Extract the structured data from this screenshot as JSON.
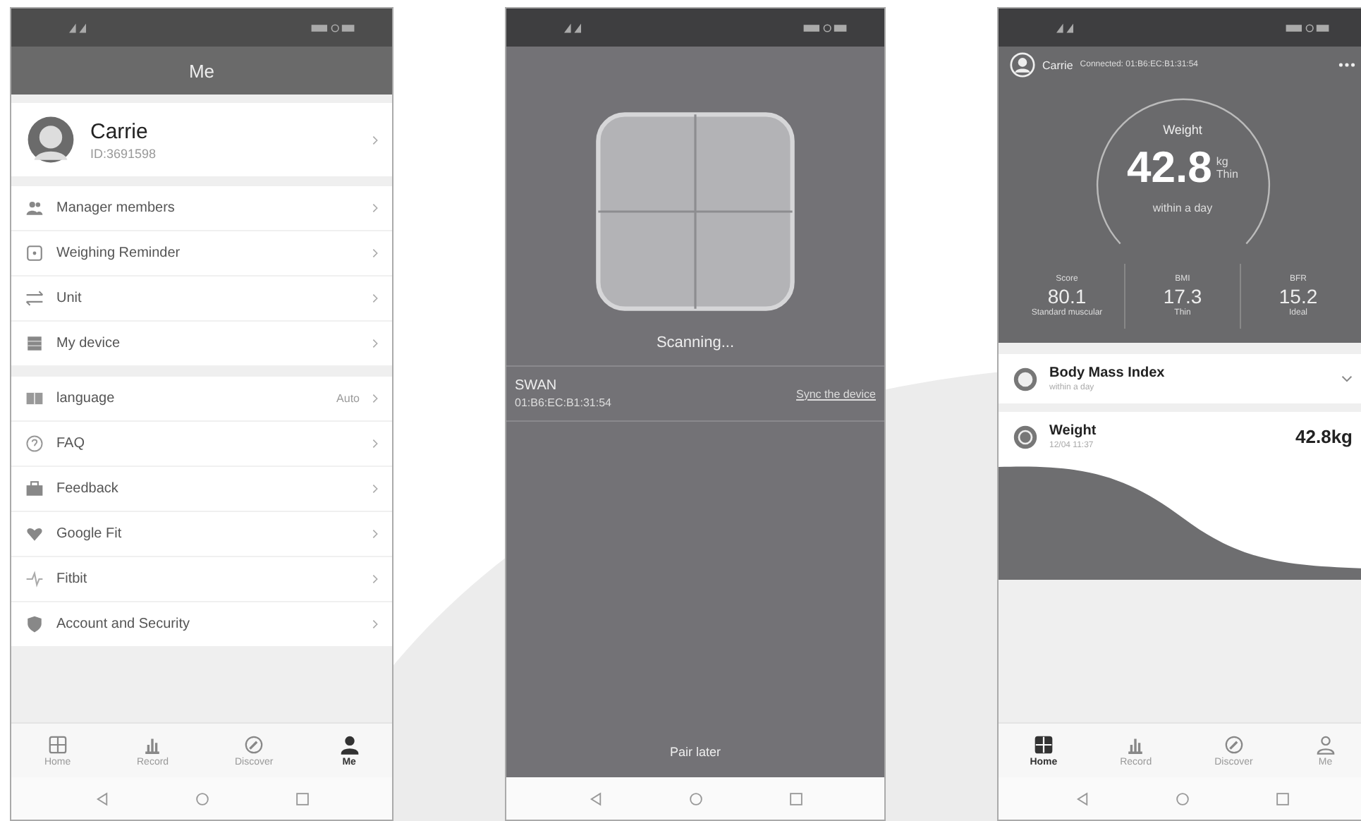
{
  "me_screen": {
    "title": "Me",
    "profile": {
      "name": "Carrie",
      "id": "ID:3691598"
    },
    "menu_groups": [
      [
        {
          "label": "Manager members"
        },
        {
          "label": "Weighing Reminder"
        },
        {
          "label": "Unit"
        },
        {
          "label": "My device"
        }
      ],
      [
        {
          "label": "language",
          "value": "Auto"
        },
        {
          "label": "FAQ"
        },
        {
          "label": "Feedback"
        },
        {
          "label": "Google Fit"
        },
        {
          "label": "Fitbit"
        },
        {
          "label": "Account and Security"
        }
      ]
    ],
    "tabs": [
      {
        "label": "Home",
        "selected": false
      },
      {
        "label": "Record",
        "selected": false
      },
      {
        "label": "Discover",
        "selected": false
      },
      {
        "label": "Me",
        "selected": true
      }
    ]
  },
  "scan_screen": {
    "status": "Scanning...",
    "device": {
      "name": "SWAN",
      "address": "01:B6:EC:B1:31:54",
      "action": "Sync the device"
    },
    "footer_button": "Pair later"
  },
  "dashboard_screen": {
    "user": "Carrie",
    "connection": "Connected: 01:B6:EC:B1:31:54",
    "gauge": {
      "label": "Weight",
      "value": "42.8",
      "unit": "kg",
      "status": "Thin",
      "period": "within a day"
    },
    "metrics": [
      {
        "label": "Score",
        "value": "80.1",
        "status": "Standard muscular"
      },
      {
        "label": "BMI",
        "value": "17.3",
        "status": "Thin"
      },
      {
        "label": "BFR",
        "value": "15.2",
        "status": "Ideal"
      }
    ],
    "cards": [
      {
        "title": "Body Mass Index",
        "subtitle": "within a day"
      },
      {
        "title": "Weight",
        "subtitle": "12/04 11:37",
        "value": "42.8kg"
      }
    ],
    "tabs": [
      {
        "label": "Home",
        "selected": true
      },
      {
        "label": "Record",
        "selected": false
      },
      {
        "label": "Discover",
        "selected": false
      },
      {
        "label": "Me",
        "selected": false
      }
    ]
  }
}
